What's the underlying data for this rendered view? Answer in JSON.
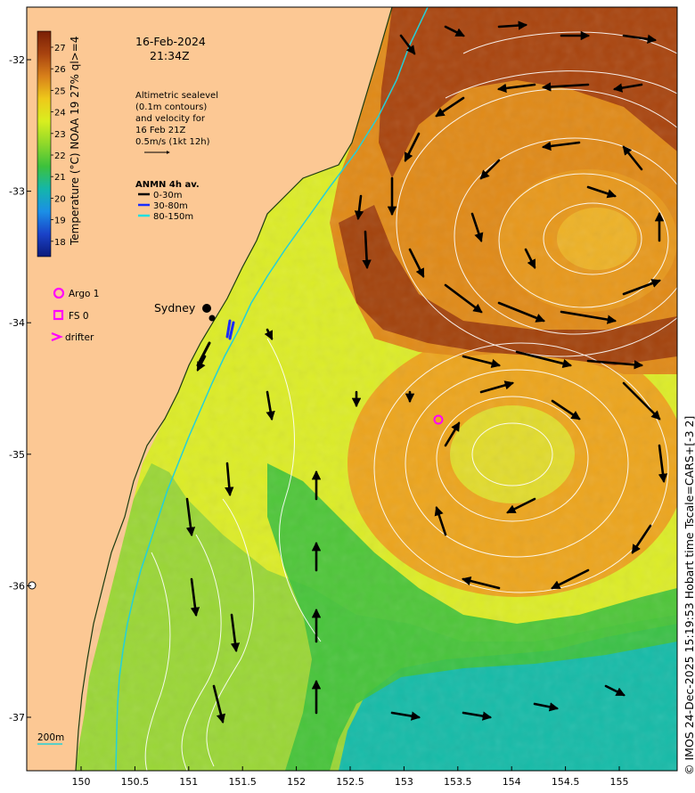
{
  "header": {
    "date": "16-Feb-2024",
    "time": "21:34Z"
  },
  "colorbar": {
    "title": "Temperature (°C) NOAA 19 27% ql>=4",
    "ticks": [
      "27",
      "26",
      "25",
      "24",
      "23",
      "22",
      "21",
      "20",
      "19",
      "18"
    ],
    "colors": [
      "#7a1f05",
      "#a8430f",
      "#d8801a",
      "#eec91a",
      "#d9ee1f",
      "#8fd82a",
      "#3cc13c",
      "#14b6aa",
      "#1b8fe6",
      "#1a42c8",
      "#0b1a7a"
    ]
  },
  "notes": {
    "lines": [
      "Altimetric sealevel",
      "(0.1m contours)",
      "and velocity for",
      "16 Feb 21Z",
      "0.5m/s (1kt 12h)"
    ]
  },
  "anmn": {
    "title": "ANMN 4h av.",
    "items": [
      {
        "label": "0-30m",
        "color": "#000000"
      },
      {
        "label": "30-80m",
        "color": "#1a2cff"
      },
      {
        "label": "80-150m",
        "color": "#20e0e0"
      }
    ]
  },
  "legend": {
    "argo": "Argo 1",
    "fs": "FS 0",
    "drifter": "drifter",
    "marker_color": "#ff00ff"
  },
  "places": {
    "sydney": "Sydney"
  },
  "depth_scale": "200m",
  "axes": {
    "lon_ticks": [
      "150",
      "150.5",
      "151",
      "151.5",
      "152",
      "152.5",
      "153",
      "153.5",
      "154",
      "154.5",
      "155"
    ],
    "lat_ticks": [
      "-32",
      "-33",
      "-34",
      "-35",
      "-36",
      "-37"
    ]
  },
  "colors": {
    "land": "#fcc894",
    "isobath": "#24d0d8",
    "contour": "#ffffff",
    "arrow": "#000000"
  },
  "credit": "© IMOS 24-Dec-2025 15:19:53 Hobart time Tscale=CARS+[-3 2]"
}
